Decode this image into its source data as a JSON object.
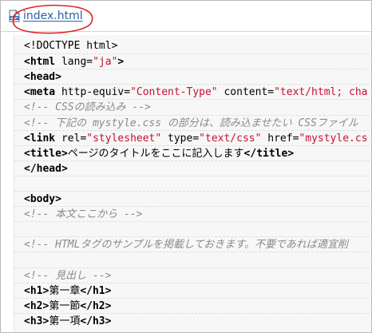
{
  "file_tab": {
    "icon": "html-file-icon",
    "name": "index.html",
    "highlight_color": "#e02020"
  },
  "colors": {
    "tag": "#000000",
    "string": "#c8102e",
    "comment": "#8a8a8a",
    "link": "#2a62a8"
  },
  "code_lines": [
    [
      {
        "t": "text",
        "v": "<!DOCTYPE html>"
      }
    ],
    [
      {
        "t": "tag",
        "v": "<html "
      },
      {
        "t": "attr",
        "v": "lang="
      },
      {
        "t": "str",
        "v": "\"ja\""
      },
      {
        "t": "tag",
        "v": ">"
      }
    ],
    [
      {
        "t": "tag",
        "v": "<head>"
      }
    ],
    [
      {
        "t": "tag",
        "v": "<meta "
      },
      {
        "t": "attr",
        "v": "http-equiv="
      },
      {
        "t": "str",
        "v": "\"Content-Type\""
      },
      {
        "t": "attr",
        "v": " content="
      },
      {
        "t": "str",
        "v": "\"text/html; cha"
      }
    ],
    [
      {
        "t": "comment",
        "v": "<!-- CSSの読み込み -->"
      }
    ],
    [
      {
        "t": "comment",
        "v": "<!-- 下記の mystyle.css の部分は、読み込ませたい CSSファイル"
      }
    ],
    [
      {
        "t": "tag",
        "v": "<link "
      },
      {
        "t": "attr",
        "v": "rel="
      },
      {
        "t": "str",
        "v": "\"stylesheet\""
      },
      {
        "t": "attr",
        "v": " type="
      },
      {
        "t": "str",
        "v": "\"text/css\""
      },
      {
        "t": "attr",
        "v": " href="
      },
      {
        "t": "str",
        "v": "\"mystyle.cs"
      }
    ],
    [
      {
        "t": "tag",
        "v": "<title>"
      },
      {
        "t": "text",
        "v": "ページのタイトルをここに記入します"
      },
      {
        "t": "tag",
        "v": "</title>"
      }
    ],
    [
      {
        "t": "tag",
        "v": "</head>"
      }
    ],
    [],
    [
      {
        "t": "tag",
        "v": "<body>"
      }
    ],
    [
      {
        "t": "comment",
        "v": "<!-- 本文ここから -->"
      }
    ],
    [],
    [
      {
        "t": "comment",
        "v": "<!-- HTMLタグのサンプルを掲載しておきます。不要であれば適宜削"
      }
    ],
    [],
    [
      {
        "t": "comment",
        "v": "<!-- 見出し -->"
      }
    ],
    [
      {
        "t": "tag",
        "v": "<h1>"
      },
      {
        "t": "text",
        "v": "第一章"
      },
      {
        "t": "tag",
        "v": "</h1>"
      }
    ],
    [
      {
        "t": "tag",
        "v": "<h2>"
      },
      {
        "t": "text",
        "v": "第一節"
      },
      {
        "t": "tag",
        "v": "</h2>"
      }
    ],
    [
      {
        "t": "tag",
        "v": "<h3>"
      },
      {
        "t": "text",
        "v": "第一項"
      },
      {
        "t": "tag",
        "v": "</h3>"
      }
    ]
  ]
}
